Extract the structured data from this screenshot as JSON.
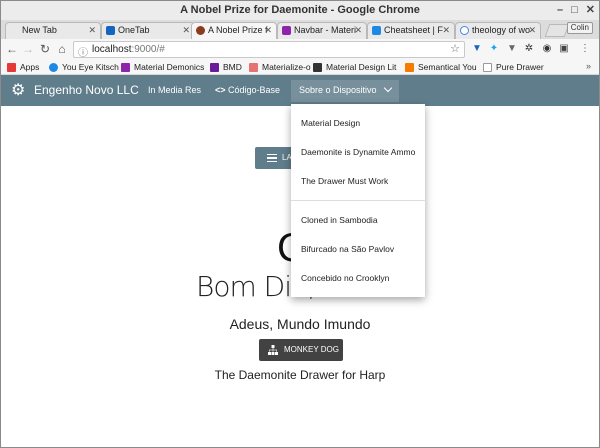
{
  "window": {
    "title": "A Nobel Prize for Daemonite - Google Chrome"
  },
  "tabs": [
    {
      "label": "New Tab",
      "color": "#cccccc"
    },
    {
      "label": "OneTab",
      "color": "#1565c0"
    },
    {
      "label": "A Nobel Prize f",
      "color": "#8d3b1f"
    },
    {
      "label": "Navbar - Materi",
      "color": "#8e24aa"
    },
    {
      "label": "Cheatsheet | F",
      "color": "#1e88e5"
    },
    {
      "label": "theology of wo",
      "color": "#4285f4"
    }
  ],
  "profile_button": "Colin",
  "address": {
    "host": "localhost",
    "rest": ":9000/#"
  },
  "bookmarks": [
    {
      "label": "Apps",
      "color": "#e53935"
    },
    {
      "label": "You Eye Kitsch",
      "color": "#1e88e5"
    },
    {
      "label": "Material Demonics",
      "color": "#8e24aa"
    },
    {
      "label": "BMD",
      "color": "#6a1b9a"
    },
    {
      "label": "Materialize-o",
      "color": "#e57373"
    },
    {
      "label": "Material Design Lit",
      "color": "#333333"
    },
    {
      "label": "Semantical You",
      "color": "#f57c00"
    },
    {
      "label": "Pure Drawer",
      "color": "#999999"
    }
  ],
  "appnav": {
    "brand": "Engenho Novo LLC",
    "links": {
      "media": "In Media Res",
      "code": "Código-Base",
      "about": "Sobre o Dispositivo"
    },
    "color": "#607d8b"
  },
  "dropdown": {
    "items": [
      "Material Design",
      "Daemonite is Dynamite Ammo",
      "The Drawer Must Work",
      "Cloned in Sambodia",
      "Bifurcado na São Pavlov",
      "Concebido no Crooklyn"
    ]
  },
  "page": {
    "launch_button": "LA",
    "big_letter": "C",
    "greeting": "Bom Dia,",
    "subtitle": "Adeus, Mundo Imundo",
    "monkey_button": "MONKEY DOG",
    "footer": "The Daemonite Drawer for Harp"
  }
}
